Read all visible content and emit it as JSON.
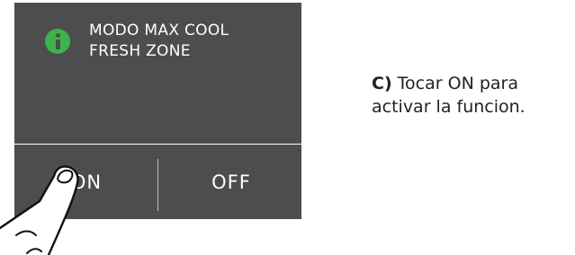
{
  "panel": {
    "message_line1": "MODO MAX COOL",
    "message_line2": "FRESH ZONE",
    "on_label": "ON",
    "off_label": "OFF",
    "icon": "info-icon",
    "icon_color": "#3cb44b",
    "background_color": "#4b4d4f"
  },
  "instruction": {
    "step": "C)",
    "line1_text": " Tocar ON para",
    "line2_text": "activar la funcion."
  },
  "hand_icon": "pointing-hand-icon"
}
